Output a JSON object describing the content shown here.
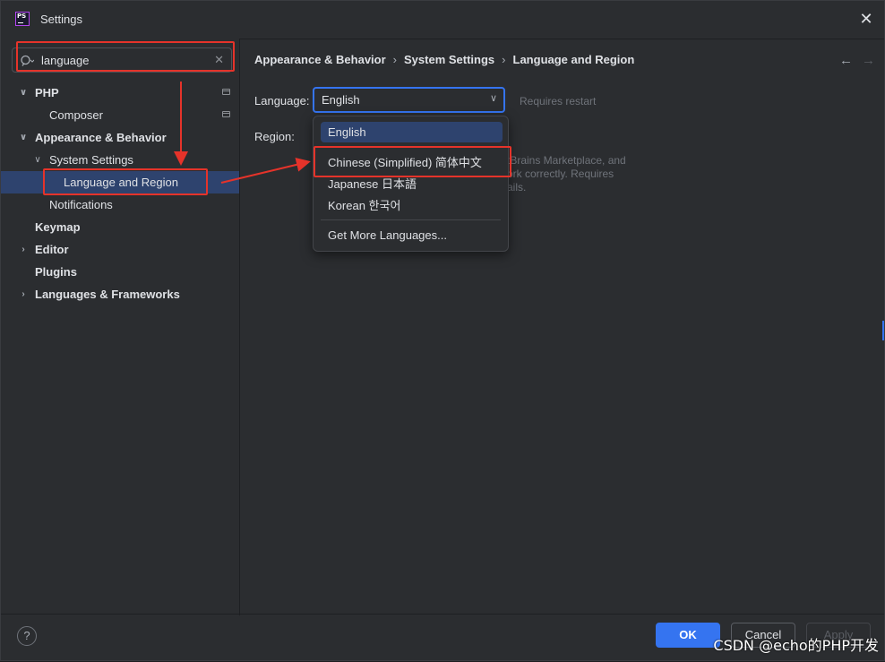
{
  "window": {
    "title": "Settings",
    "logo_text": "PS",
    "close_glyph": "✕"
  },
  "search": {
    "value": "language",
    "clear_glyph": "✕"
  },
  "tree": [
    {
      "label": "PHP",
      "bold": true,
      "expanded": true,
      "level": 0,
      "has_chevron": true,
      "project_icon": true
    },
    {
      "label": "Composer",
      "bold": false,
      "level": 1,
      "has_chevron": false,
      "project_icon": true
    },
    {
      "label": "Appearance & Behavior",
      "bold": true,
      "expanded": true,
      "level": 0,
      "has_chevron": true
    },
    {
      "label": "System Settings",
      "bold": false,
      "expanded": true,
      "level": 1,
      "has_chevron": true
    },
    {
      "label": "Language and Region",
      "bold": false,
      "level": 2,
      "has_chevron": false,
      "selected": true
    },
    {
      "label": "Notifications",
      "bold": false,
      "level": 1,
      "has_chevron": false
    },
    {
      "label": "Keymap",
      "bold": true,
      "level": 0,
      "has_chevron": false
    },
    {
      "label": "Editor",
      "bold": true,
      "expanded": false,
      "level": 0,
      "has_chevron": true
    },
    {
      "label": "Plugins",
      "bold": true,
      "level": 0,
      "has_chevron": false
    },
    {
      "label": "Languages & Frameworks",
      "bold": true,
      "expanded": false,
      "level": 0,
      "has_chevron": true
    }
  ],
  "breadcrumb": {
    "items": [
      "Appearance & Behavior",
      "System Settings",
      "Language and Region"
    ],
    "separator": "›"
  },
  "nav": {
    "back_glyph": "←",
    "forward_glyph": "→"
  },
  "form": {
    "language_label": "Language:",
    "language_value": "English",
    "requires_restart": "Requires restart",
    "region_label": "Region:",
    "hint_lines": [
      "tBrains Marketplace, and",
      "ork correctly. Requires",
      "ails."
    ]
  },
  "dropdown": {
    "options": [
      {
        "label": "English",
        "selected": true
      },
      {
        "label": "Chinese (Simplified) 简体中文",
        "selected": false
      },
      {
        "label": "Japanese 日本語",
        "selected": false
      },
      {
        "label": "Korean 한국어",
        "selected": false
      }
    ],
    "more": "Get More Languages..."
  },
  "footer": {
    "help_label": "?",
    "ok_label": "OK",
    "cancel_label": "Cancel",
    "apply_label": "Apply"
  },
  "watermark": "CSDN @echo的PHP开发",
  "colors": {
    "background": "#2b2d30",
    "accent": "#3574f0",
    "selection": "#2e436e",
    "annotation_red": "#e5332a"
  }
}
